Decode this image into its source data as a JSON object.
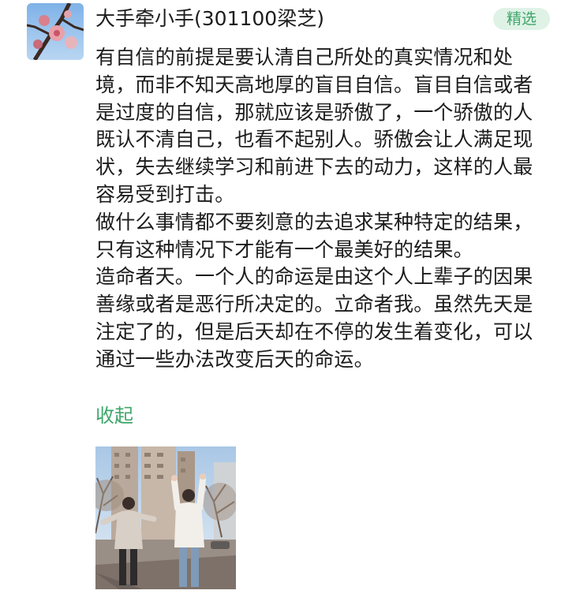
{
  "post": {
    "author": "大手牵小手(301100梁芝)",
    "badge": "精选",
    "paragraphs": [
      "有自信的前提是要认清自己所处的真实情况和处境，而非不知天高地厚的盲目自信。盲目自信或者是过度的自信，那就应该是骄傲了，一个骄傲的人既认不清自己，也看不起别人。骄傲会让人满足现状，失去继续学习和前进下去的动力，这样的人最容易受到打击。",
      "做什么事情都不要刻意的去追求某种特定的结果，只有这种情况下才能有一个最美好的结果。",
      "造命者天。一个人的命运是由这个人上辈子的因果善缘或者是恶行所决定的。立命者我。虽然先天是注定了的，但是后天却在不停的发生着变化，可以通过一些办法改变后天的命运。"
    ],
    "collapse_label": "收起"
  },
  "colors": {
    "accent": "#3fa66a",
    "badge_bg": "#dff2e6",
    "text": "#1c1c1c"
  }
}
